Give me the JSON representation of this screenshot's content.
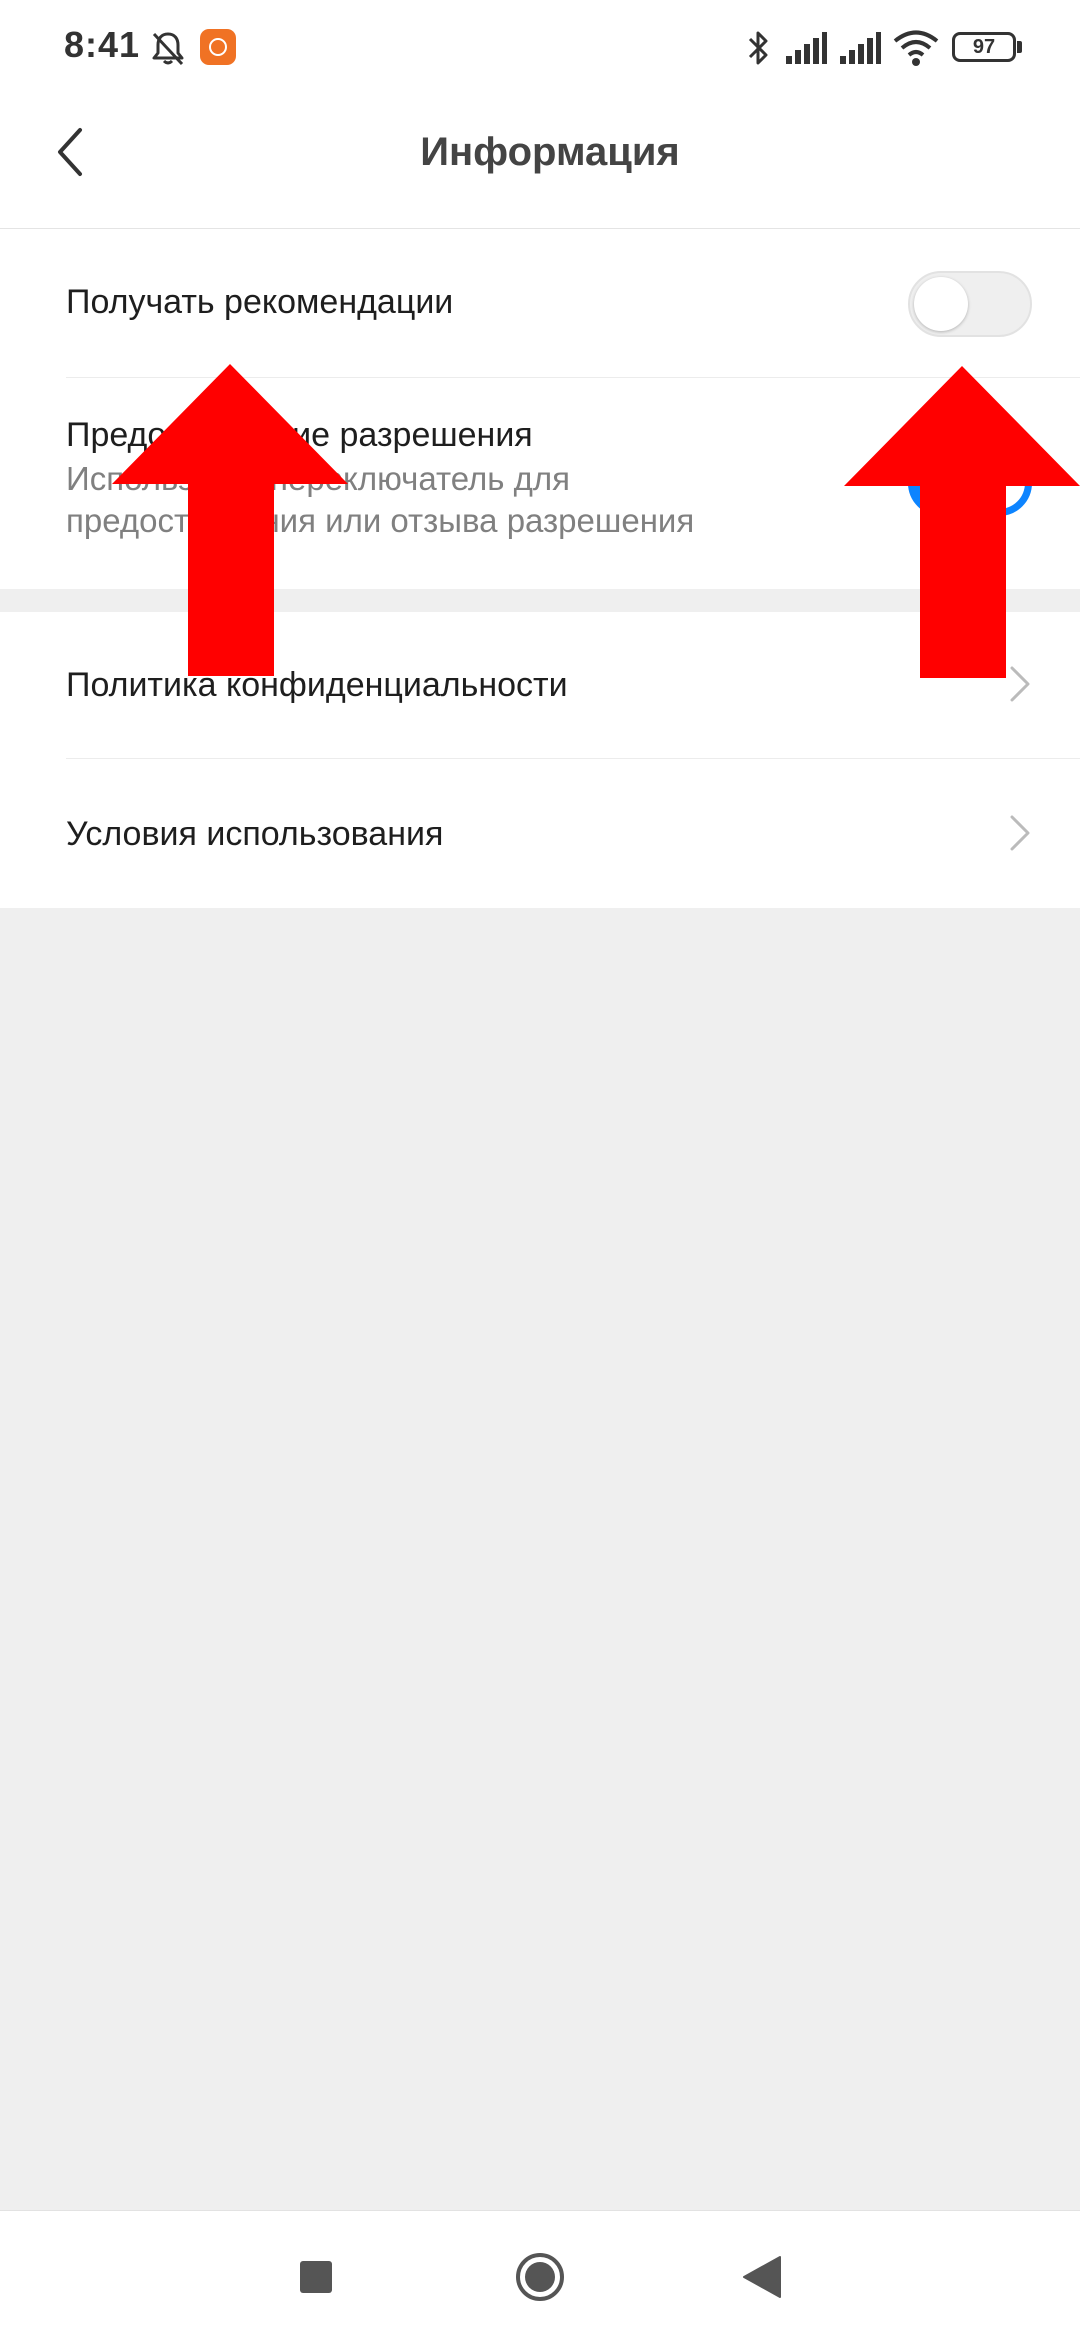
{
  "status_bar": {
    "time": "8:41",
    "battery": "97",
    "icons": [
      "muted-bell-icon",
      "mi-app-badge-icon",
      "bluetooth-icon",
      "signal-icon",
      "signal-icon",
      "wifi-icon",
      "battery-icon"
    ]
  },
  "header": {
    "back_icon": "chevron-left-icon",
    "title": "Информация"
  },
  "settings": {
    "recommendations": {
      "title": "Получать рекомендации",
      "toggle_on": false
    },
    "permission": {
      "title": "Предоставление разрешения",
      "summary": "Используйте переключатель для предоставления или отзыва разрешения",
      "toggle_on": true
    },
    "privacy": {
      "title": "Политика конфиденциальности",
      "icon": "chevron-right-icon"
    },
    "terms": {
      "title": "Условия использования",
      "icon": "chevron-right-icon"
    }
  },
  "overlay": {
    "arrows": [
      "red-arrow-up-icon",
      "red-arrow-up-icon"
    ],
    "color": "#ff0000"
  },
  "nav_bar": {
    "icons": [
      "square-recents-icon",
      "circle-home-icon",
      "triangle-back-icon"
    ]
  },
  "colors": {
    "accent": "#0d84ff",
    "background": "#efefef",
    "surface": "#ffffff",
    "arrow": "#ff0000"
  }
}
